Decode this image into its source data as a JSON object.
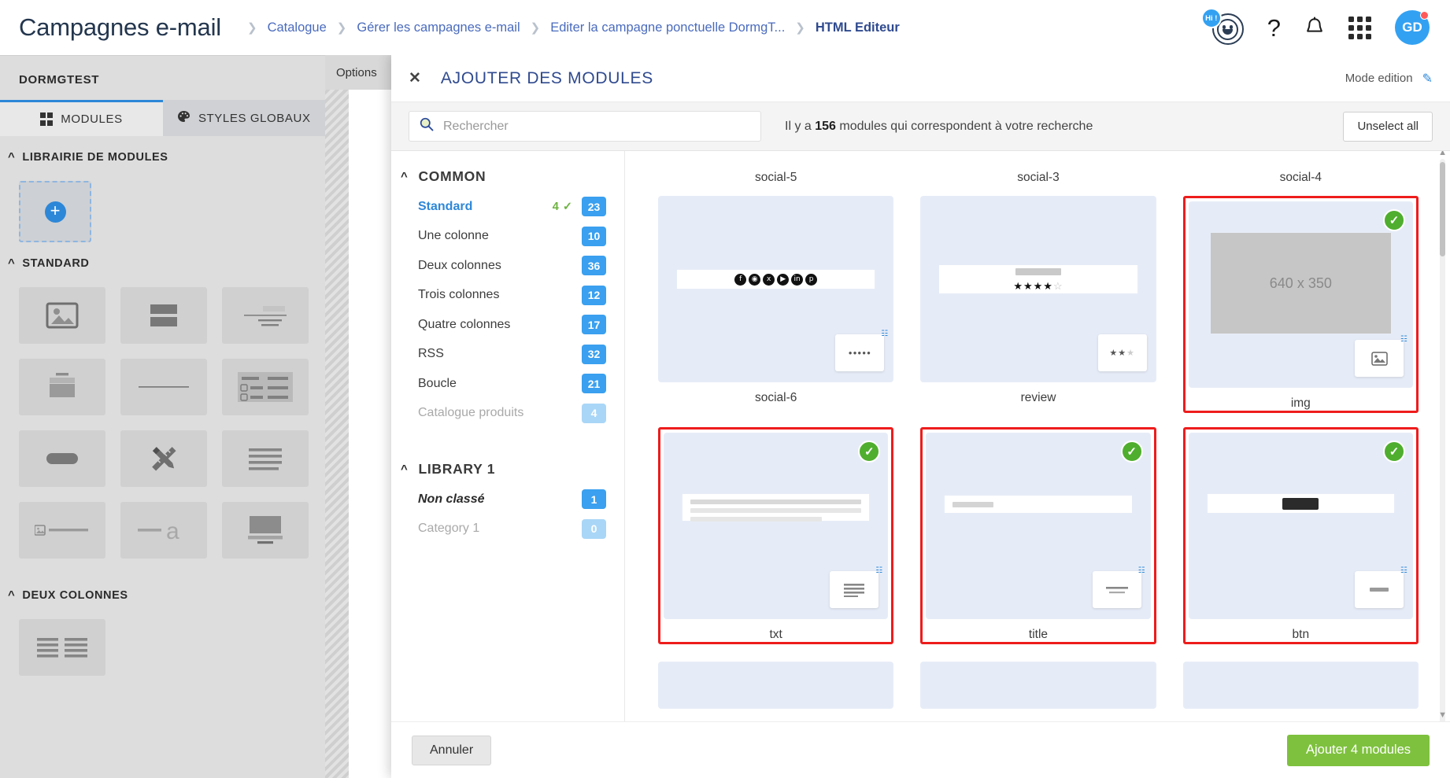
{
  "header": {
    "app_title": "Campagnes e-mail",
    "breadcrumb": [
      {
        "label": "Catalogue",
        "active": false
      },
      {
        "label": "Gérer les campagnes e-mail",
        "active": false
      },
      {
        "label": "Editer la campagne ponctuelle DormgT...",
        "active": false
      },
      {
        "label": "HTML Editeur",
        "active": true
      }
    ],
    "icons": {
      "assistant": "chatbot-avatar-icon",
      "assistant_badge": "Hi !",
      "help": "?",
      "notifications": "bell-icon",
      "apps": "grid-menu-icon",
      "user_initials": "GD"
    }
  },
  "sidebar": {
    "title": "DORMGTEST",
    "tabs": [
      {
        "label": "MODULES",
        "icon": "grid-icon",
        "active": true
      },
      {
        "label": "STYLES GLOBAUX",
        "icon": "palette-icon",
        "active": false
      }
    ],
    "sections": [
      {
        "label": "LIBRAIRIE DE MODULES"
      },
      {
        "label": "STANDARD"
      },
      {
        "label": "DEUX COLONNES"
      }
    ],
    "add_module_label": "+",
    "standard_tiles": [
      "image-icon",
      "two-blocks-icon",
      "heading-lines-icon",
      "card-icon",
      "divider-icon",
      "list-rows-icon",
      "button-icon",
      "ruler-pencil-icon",
      "text-lines-icon",
      "image-text-icon",
      "dash-letter-icon",
      "video-icon"
    ],
    "two_column_tiles": [
      "two-column-text-icon"
    ]
  },
  "editor": {
    "options_tab_label": "Options"
  },
  "modal": {
    "close_icon": "close-icon",
    "title": "AJOUTER DES MODULES",
    "mode_label": "Mode edition",
    "mode_icon": "pencil-icon",
    "search": {
      "placeholder": "Rechercher",
      "value": "",
      "icon": "search-icon"
    },
    "result_prefix": "Il y a ",
    "result_count": "156",
    "result_suffix": " modules qui correspondent à votre recherche",
    "unselect_label": "Unselect all",
    "categories": [
      {
        "group": "COMMON",
        "items": [
          {
            "label": "Standard",
            "count": "23",
            "active": true,
            "selected_count": "4",
            "muted": false
          },
          {
            "label": "Une colonne",
            "count": "10",
            "active": false,
            "muted": false
          },
          {
            "label": "Deux colonnes",
            "count": "36",
            "active": false,
            "muted": false
          },
          {
            "label": "Trois colonnes",
            "count": "12",
            "active": false,
            "muted": false
          },
          {
            "label": "Quatre colonnes",
            "count": "17",
            "active": false,
            "muted": false
          },
          {
            "label": "RSS",
            "count": "32",
            "active": false,
            "muted": false
          },
          {
            "label": "Boucle",
            "count": "21",
            "active": false,
            "muted": false
          },
          {
            "label": "Catalogue produits",
            "count": "4",
            "active": false,
            "muted": true
          }
        ]
      },
      {
        "group": "LIBRARY 1",
        "items": [
          {
            "label": "Non classé",
            "count": "1",
            "active": false,
            "muted": false,
            "italic": true
          },
          {
            "label": "Category 1",
            "count": "0",
            "active": false,
            "muted": true
          }
        ]
      }
    ],
    "cards_row1_labels": [
      "social-5",
      "social-3",
      "social-4"
    ],
    "cards": [
      {
        "name": "social-6",
        "selected": false,
        "kind": "social",
        "mini": "social-mini"
      },
      {
        "name": "review",
        "selected": false,
        "kind": "review",
        "mini": "star-mini"
      },
      {
        "name": "img",
        "selected": true,
        "kind": "image",
        "placeholder": "640 x 350",
        "mini": "image-mini"
      },
      {
        "name": "txt",
        "selected": true,
        "kind": "text",
        "mini": "text-mini"
      },
      {
        "name": "title",
        "selected": true,
        "kind": "title",
        "mini": "title-mini"
      },
      {
        "name": "btn",
        "selected": true,
        "kind": "button",
        "mini": "button-mini"
      }
    ],
    "footer": {
      "cancel_label": "Annuler",
      "add_label": "Ajouter 4 modules"
    }
  },
  "colors": {
    "brand_blue": "#2d87d8",
    "breadcrumb_blue": "#4a6bbd",
    "badge_blue": "#3aa0ef",
    "select_red": "#ee1c1c",
    "check_green": "#4fae2e",
    "add_green": "#7ec13e",
    "sidebar_gray": "#dddddd"
  }
}
